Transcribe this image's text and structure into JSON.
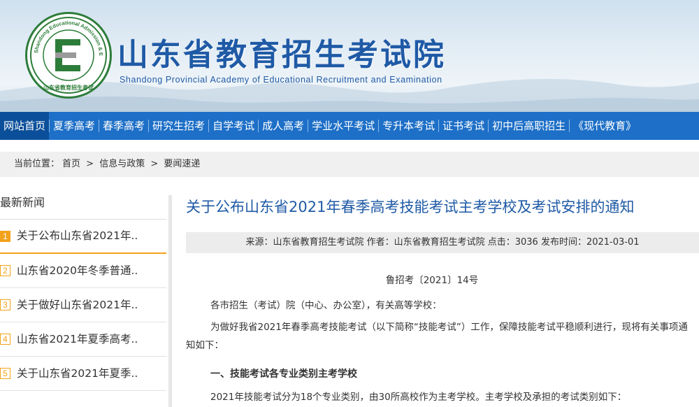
{
  "header": {
    "logo_ring_text": "Shandong Educational Admission & Examinations",
    "logo_bottom_text": "山东省教育招生考试",
    "title": "山东省教育招生考试院",
    "subtitle": "Shandong Provincial Academy of Educational Recruitment and Examination"
  },
  "nav": {
    "items": [
      "网站首页",
      "夏季高考",
      "春季高考",
      "研究生招考",
      "自学考试",
      "成人高考",
      "学业水平考试",
      "专升本考试",
      "证书考试",
      "初中后高职招生",
      "《现代教育》"
    ]
  },
  "breadcrumb": {
    "label": "当前位置：",
    "items": [
      "首页",
      "信息与政策",
      "要闻速递"
    ],
    "separator": ">"
  },
  "sidebar": {
    "title": "最新新闻",
    "items": [
      {
        "num": "1",
        "text": "关于公布山东省2021年.."
      },
      {
        "num": "2",
        "text": "山东省2020年冬季普通.."
      },
      {
        "num": "3",
        "text": "关于做好山东省2021年.."
      },
      {
        "num": "4",
        "text": "山东省2021年夏季高考.."
      },
      {
        "num": "5",
        "text": "关于山东省2021年夏季.."
      }
    ]
  },
  "article": {
    "title": "关于公布山东省2021年春季高考技能考试主考学校及考试安排的通知",
    "meta": "来源：山东省教育招生考试院 作者：山东省教育招生考试院 点击：3036 发布时间：2021-03-01",
    "doc_no": "鲁招考〔2021〕14号",
    "p1": "各市招生（考试）院（中心、办公室），有关高等学校：",
    "p2": "为做好我省2021年春季高考技能考试（以下简称“技能考试”）工作，保障技能考试平稳顺利进行，现将有关事项通知如下：",
    "heading1": "一、技能考试各专业类别主考学校",
    "p3": "2021年技能考试分为18个专业类别，由30所高校作为主考学校。主考学校及承担的考试类别如下："
  },
  "colors": {
    "brand_blue": "#1d6fc7",
    "title_blue": "#1f5aa6",
    "accent_orange": "#f3a21b",
    "logo_green": "#2d7d3a"
  }
}
